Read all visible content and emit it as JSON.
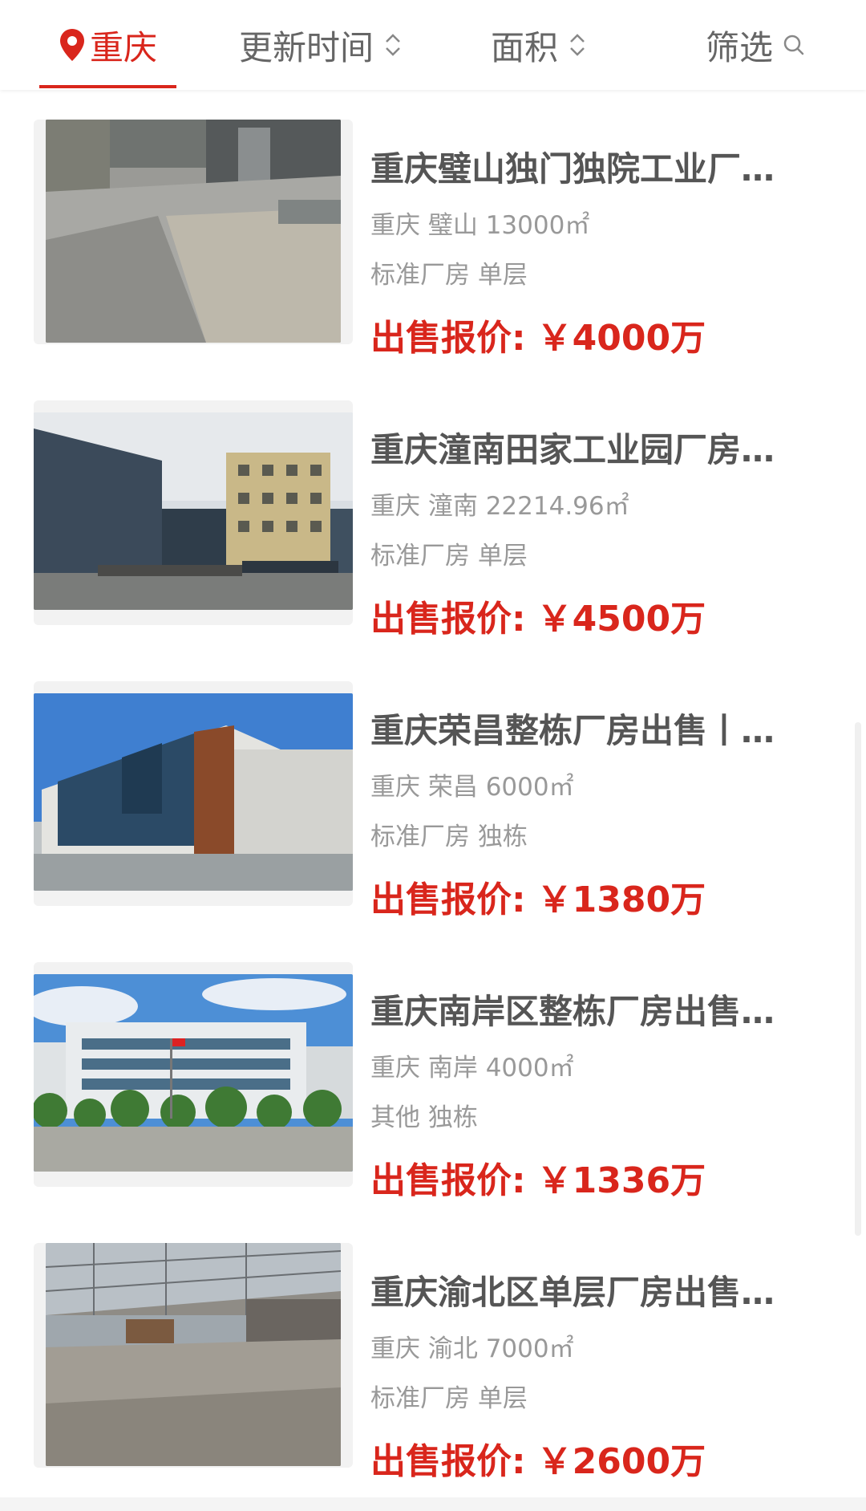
{
  "filter_bar": {
    "city": "重庆",
    "update_time": "更新时间",
    "area": "面积",
    "filter": "筛选"
  },
  "listings": [
    {
      "title": "重庆璧山独门独院工业厂…",
      "location": "重庆 璧山 13000㎡",
      "tags": "标准厂房 单层",
      "price_label": "出售报价:",
      "price_value": "￥4000万",
      "image": "factory-yard-road-photo"
    },
    {
      "title": "重庆潼南田家工业园厂房…",
      "location": "重庆 潼南 22214.96㎡",
      "tags": "标准厂房 单层",
      "price_label": "出售报价:",
      "price_value": "￥4500万",
      "image": "industrial-park-buildings-photo"
    },
    {
      "title": "重庆荣昌整栋厂房出售丨…",
      "location": "重庆 荣昌 6000㎡",
      "tags": "标准厂房 独栋",
      "price_label": "出售报价:",
      "price_value": "￥1380万",
      "image": "modern-factory-building-photo"
    },
    {
      "title": "重庆南岸区整栋厂房出售…",
      "location": "重庆 南岸 4000㎡",
      "tags": "其他 独栋",
      "price_label": "出售报价:",
      "price_value": "￥1336万",
      "image": "office-building-with-trees-photo"
    },
    {
      "title": "重庆渝北区单层厂房出售…",
      "location": "重庆 渝北 7000㎡",
      "tags": "标准厂房 单层",
      "price_label": "出售报价:",
      "price_value": "￥2600万",
      "image": "warehouse-interior-photo"
    }
  ],
  "colors": {
    "accent": "#d9261c",
    "title": "#555555",
    "meta": "#999999"
  }
}
